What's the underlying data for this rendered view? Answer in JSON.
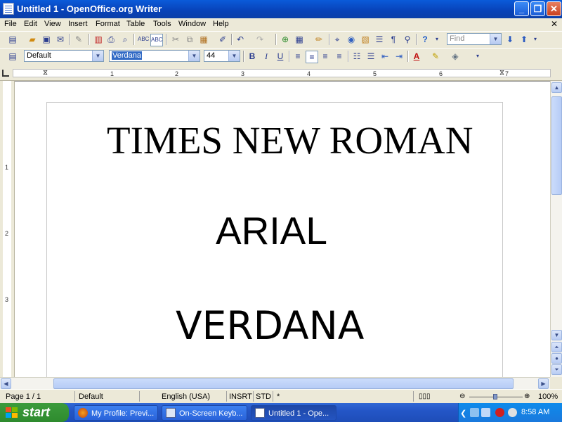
{
  "window": {
    "title": "Untitled 1 - OpenOffice.org Writer"
  },
  "menu": {
    "items": [
      "File",
      "Edit",
      "View",
      "Insert",
      "Format",
      "Table",
      "Tools",
      "Window",
      "Help"
    ]
  },
  "toolbar": {
    "find_placeholder": "Find"
  },
  "format": {
    "style": "Default",
    "font": "Verdana",
    "size": "44"
  },
  "ruler": {
    "marks": [
      "1",
      "2",
      "3",
      "4",
      "5",
      "6",
      "7"
    ],
    "vmarks": [
      "1",
      "2",
      "3"
    ]
  },
  "document": {
    "lines": [
      "TIMES NEW ROMAN",
      "ARIAL",
      "VERDANA"
    ]
  },
  "status": {
    "page": "Page 1 / 1",
    "style": "Default",
    "language": "English (USA)",
    "insert_mode": "INSRT",
    "selection_mode": "STD",
    "modified": "*",
    "zoom": "100%"
  },
  "taskbar": {
    "start_label": "start",
    "tasks": [
      {
        "label": "My Profile: Previ..."
      },
      {
        "label": "On-Screen Keyb..."
      },
      {
        "label": "Untitled 1 - Ope..."
      }
    ],
    "clock": "8:58 AM"
  },
  "colors": {
    "title_bar": "#0A5BD9",
    "taskbar": "#2456C7",
    "start": "#2E8B2E",
    "selection": "#316AC5"
  }
}
